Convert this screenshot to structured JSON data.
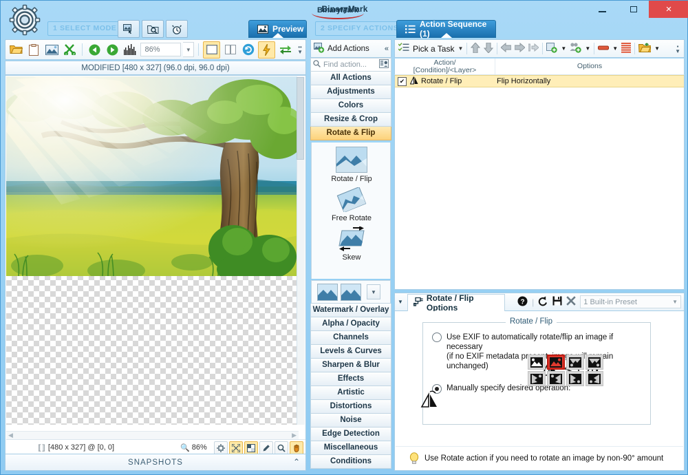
{
  "window": {
    "title": "BinaryMark",
    "brand": "BinaryMark",
    "minimize": "minimize-button",
    "maximize": "maximize-button",
    "close": "×"
  },
  "steps": {
    "select_mode": "1 SELECT MODE",
    "specify_actions": "2 SPECIFY ACTIONS",
    "preview_tab": "Preview",
    "action_sequence_tab": "Action Sequence (1)"
  },
  "preview": {
    "header": "MODIFIED [480 x 327] (96.0 dpi, 96.0 dpi)",
    "zoom_value": "86%",
    "status_dimensions": "[480 x 327] @ [0, 0]",
    "status_zoom": "86%",
    "snapshots_label": "SNAPSHOTS"
  },
  "actions_panel": {
    "add_actions": "Add Actions",
    "collapse": "«",
    "find_placeholder": "Find action...",
    "categories_top": [
      "All Actions",
      "Adjustments",
      "Colors",
      "Resize & Crop",
      "Rotate & Flip"
    ],
    "active_category": "Rotate & Flip",
    "items": [
      {
        "name": "Rotate / Flip"
      },
      {
        "name": "Free Rotate"
      },
      {
        "name": "Skew"
      }
    ],
    "categories_bottom": [
      "Watermark / Overlay",
      "Alpha / Opacity",
      "Channels",
      "Levels & Curves",
      "Sharpen & Blur",
      "Effects",
      "Artistic",
      "Distortions",
      "Noise",
      "Edge Detection",
      "Miscellaneous",
      "Conditions"
    ]
  },
  "sequence": {
    "pick_a_task": "Pick a Task",
    "col_action": "Action/",
    "col_action2": "[Condition]/<Layer>",
    "col_options": "Options",
    "rows": [
      {
        "checked": "✔",
        "action": "Rotate / Flip",
        "options": "Flip Horizontally"
      }
    ]
  },
  "options": {
    "tab_title": "Rotate / Flip Options",
    "preset": "1 Built-in Preset",
    "group_title": "Rotate / Flip",
    "radio_exif_line1": "Use EXIF to automatically rotate/flip an image if necessary",
    "radio_exif_line2": "(if no EXIF metadata present, image will remain unchanged)",
    "radio_manual": "Manually specify desired operation:",
    "selected_mode": "manual",
    "selected_operation_index": 1,
    "tip": "Use Rotate action if you need to rotate an image by non-90° amount"
  },
  "colors": {
    "window_bg": "#9bd2f4",
    "accent_tab": "#1a6fae",
    "active_category": "#fcd27a",
    "selected_row": "#ffeeb8",
    "selected_op": "#e03a2f",
    "close_button": "#e04a4a"
  }
}
